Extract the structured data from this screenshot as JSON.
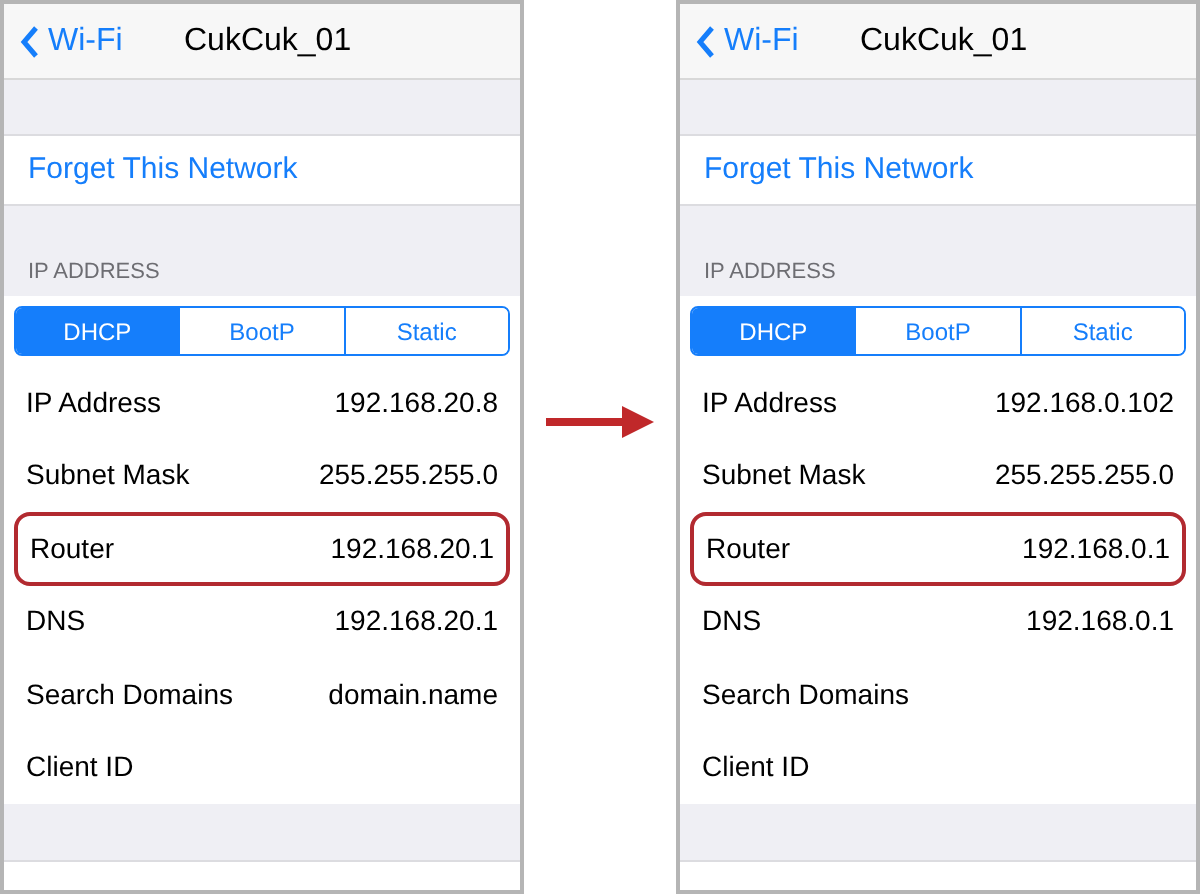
{
  "screens": [
    {
      "back": "Wi-Fi",
      "title": "CukCuk_01",
      "forget": "Forget This Network",
      "section_header": "IP ADDRESS",
      "segments": [
        {
          "label": "DHCP",
          "selected": true
        },
        {
          "label": "BootP",
          "selected": false
        },
        {
          "label": "Static",
          "selected": false
        }
      ],
      "rows": [
        {
          "label": "IP Address",
          "value": "192.168.20.8",
          "highlighted": false
        },
        {
          "label": "Subnet Mask",
          "value": "255.255.255.0",
          "highlighted": false
        },
        {
          "label": "Router",
          "value": "192.168.20.1",
          "highlighted": true
        },
        {
          "label": "DNS",
          "value": "192.168.20.1",
          "highlighted": false
        },
        {
          "label": "Search Domains",
          "value": "domain.name",
          "highlighted": false
        },
        {
          "label": "Client ID",
          "highlighted": false
        }
      ]
    },
    {
      "back": "Wi-Fi",
      "title": "CukCuk_01",
      "forget": "Forget This Network",
      "section_header": "IP ADDRESS",
      "segments": [
        {
          "label": "DHCP",
          "selected": true
        },
        {
          "label": "BootP",
          "selected": false
        },
        {
          "label": "Static",
          "selected": false
        }
      ],
      "rows": [
        {
          "label": "IP Address",
          "value": "192.168.0.102",
          "highlighted": false
        },
        {
          "label": "Subnet Mask",
          "value": "255.255.255.0",
          "highlighted": false
        },
        {
          "label": "Router",
          "value": "192.168.0.1",
          "highlighted": true
        },
        {
          "label": "DNS",
          "value": "192.168.0.1",
          "highlighted": false
        },
        {
          "label": "Search Domains",
          "highlighted": false
        },
        {
          "label": "Client ID",
          "highlighted": false
        }
      ]
    }
  ]
}
